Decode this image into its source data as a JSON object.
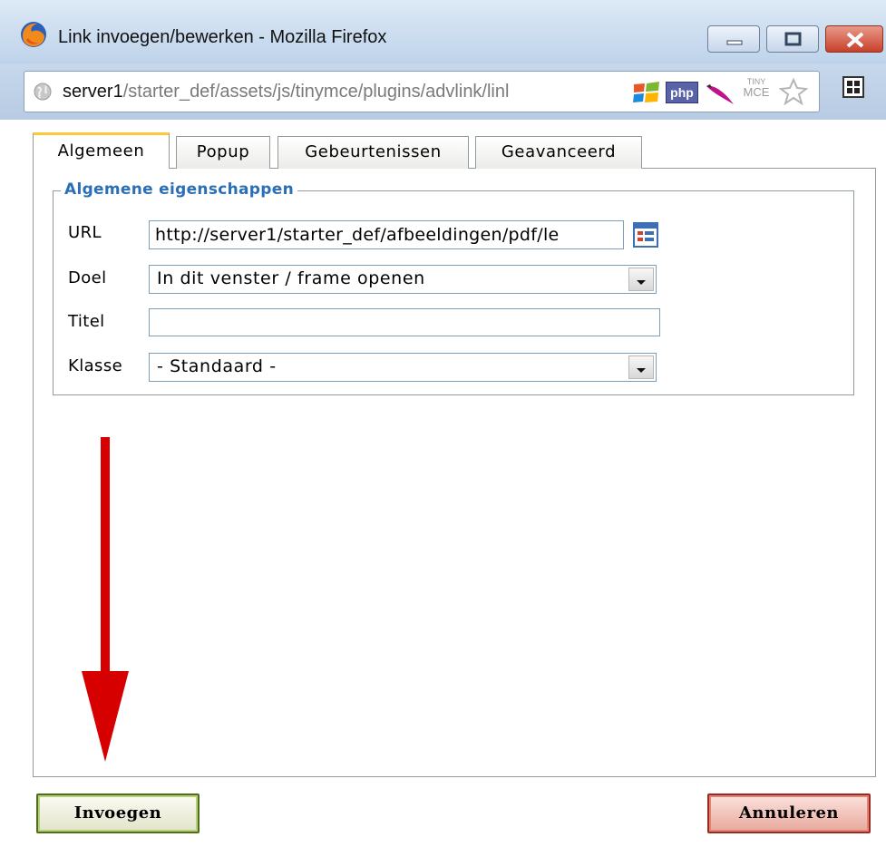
{
  "window": {
    "title": "Link invoegen/bewerken - Mozilla Firefox"
  },
  "address_bar": {
    "host": "server1",
    "path": "/starter_def/assets/js/tinymce/plugins/advlink/linl",
    "addons": [
      "windows-flag-icon",
      "php-icon",
      "feather-icon",
      "tinymce-icon",
      "star-icon"
    ],
    "php_label": "php",
    "tiny_label_top": "TINY",
    "tiny_label_bottom": "MCE"
  },
  "tabs": [
    {
      "label": "Algemeen",
      "active": true
    },
    {
      "label": "Popup",
      "active": false
    },
    {
      "label": "Gebeurtenissen",
      "active": false
    },
    {
      "label": "Geavanceerd",
      "active": false
    }
  ],
  "general": {
    "legend": "Algemene eigenschappen",
    "url_label": "URL",
    "url_value": "http://server1/starter_def/afbeeldingen/pdf/le",
    "target_label": "Doel",
    "target_value": "In dit venster / frame openen",
    "title_label": "Titel",
    "title_value": "",
    "class_label": "Klasse",
    "class_value": "- Standaard -"
  },
  "buttons": {
    "insert": "Invoegen",
    "cancel": "Annuleren"
  },
  "colors": {
    "legend": "#2b6fb6",
    "active_tab_accent": "#ffc83c",
    "annotation_arrow": "#d60000"
  }
}
